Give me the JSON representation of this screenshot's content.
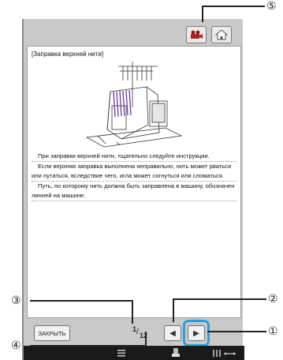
{
  "panel": {
    "title": "[Заправка верхней нити]",
    "paragraphs": [
      "При заправки верхней нити, тщательно следуйте инструкции.",
      "Если верхняя заправка выполнена неправильно, нить может рваться или путаться, вследствие чего, игла может согнуться или сломаться.",
      "Путь, по которому нить должна быть заправлена в машину, обозначен линией на машине."
    ]
  },
  "footer": {
    "close_label": "ЗАКРЫТЬ",
    "page_current": "1",
    "page_separator": "/",
    "page_total": "12",
    "prev_glyph": "◀",
    "next_glyph": "▶"
  },
  "callouts": {
    "c1": "①",
    "c2": "②",
    "c3": "③",
    "c4": "④",
    "c5": "⑤"
  },
  "icons": [
    "video-camera-icon",
    "home-icon",
    "prev-arrow-icon",
    "next-arrow-icon",
    "machine-illustration"
  ],
  "colors": {
    "screen_bg": "#c9c9c9",
    "highlight": "#2a9ed8",
    "taskbar": "#1a1a1a"
  }
}
